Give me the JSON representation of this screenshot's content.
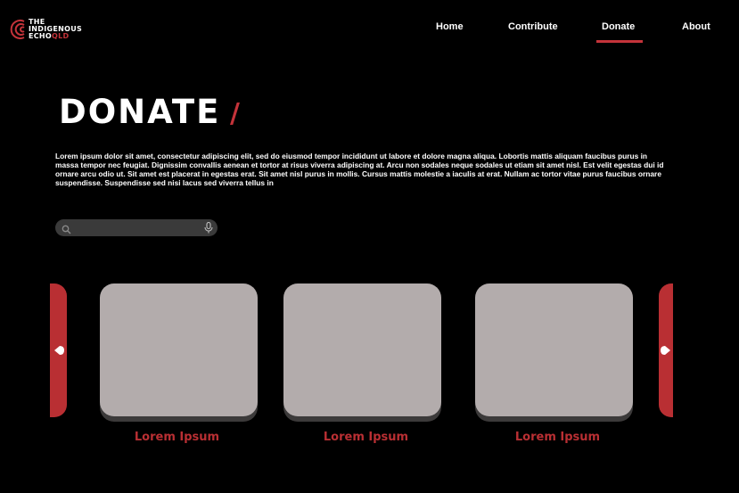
{
  "brand": {
    "line1": "THE",
    "line2": "INDIGENOUS",
    "line3a": "ECHO",
    "line3b": "QLD",
    "accent_color": "#c4333a"
  },
  "nav": {
    "items": [
      "Home",
      "Contribute",
      "Donate",
      "About"
    ],
    "active": "Donate"
  },
  "page": {
    "title": "DONATE",
    "slash": "/",
    "description": "Lorem ipsum dolor sit amet, consectetur adipiscing elit, sed do eiusmod tempor incididunt ut labore et dolore magna aliqua. Lobortis mattis aliquam faucibus purus in massa tempor nec feugiat. Dignissim convallis aenean et tortor at risus viverra adipiscing at. Arcu non sodales neque sodales ut etiam sit amet nisl. Est velit egestas dui id ornare arcu odio ut. Sit amet est placerat in egestas erat. Sit amet nisl purus in mollis. Cursus mattis molestie a iaculis at erat. Nullam ac tortor vitae purus faucibus ornare suspendisse. Suspendisse sed nisi lacus sed viverra tellus in"
  },
  "search": {
    "placeholder": "",
    "icon": "search-icon",
    "mic_icon": "microphone-icon"
  },
  "carousel": {
    "cards": [
      {
        "label": "Lorem Ipsum"
      },
      {
        "label": "Lorem Ipsum"
      },
      {
        "label": "Lorem Ipsum"
      }
    ],
    "arrow_color": "#b92f33",
    "card_color": "#b3acac"
  }
}
